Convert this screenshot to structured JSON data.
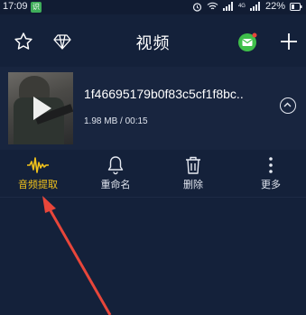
{
  "status_bar": {
    "time": "17:09",
    "app_badge": "识",
    "network_label": "4G",
    "battery_percent": "22%"
  },
  "header": {
    "title": "视频",
    "icons": [
      "star-icon",
      "diamond-icon",
      "message-icon",
      "plus-icon"
    ]
  },
  "file": {
    "name": "1f46695179b0f83c5cf1f8bc..",
    "meta": "1.98 MB / 00:15"
  },
  "actions": [
    {
      "label": "音频提取",
      "icon": "waveform-icon",
      "active": true
    },
    {
      "label": "重命名",
      "icon": "bell-icon",
      "active": false
    },
    {
      "label": "删除",
      "icon": "trash-icon",
      "active": false
    },
    {
      "label": "更多",
      "icon": "more-vertical-icon",
      "active": false
    }
  ],
  "colors": {
    "background": "#14213a",
    "accent": "#f1c21b",
    "annotation_arrow": "#e8463a",
    "message_green": "#3fbf4a"
  }
}
